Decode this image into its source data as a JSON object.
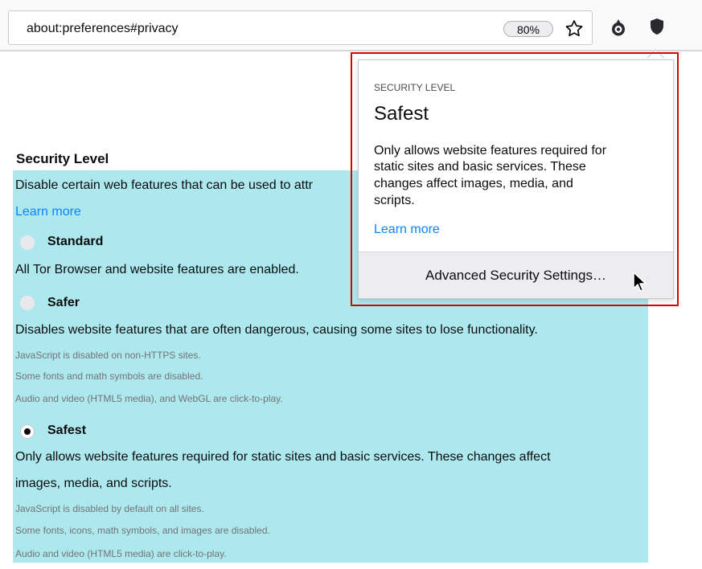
{
  "toolbar": {
    "url": "about:preferences#privacy",
    "zoom": "80%",
    "icons": [
      "star-icon",
      "onion-icon",
      "shield-icon"
    ]
  },
  "security": {
    "title": "Security Level",
    "description": "Disable certain web features that can be used to attr",
    "learn_more": "Learn more",
    "options": {
      "standard": {
        "label": "Standard",
        "description": "All Tor Browser and website features are enabled.",
        "checked": false
      },
      "safer": {
        "label": "Safer",
        "description": "Disables website features that are often dangerous, causing some sites to lose functionality.",
        "notes": [
          "JavaScript is disabled on non-HTTPS sites.",
          "Some fonts and math symbols are disabled.",
          "Audio and video (HTML5 media), and WebGL are click-to-play."
        ],
        "checked": false
      },
      "safest": {
        "label": "Safest",
        "description_line1": "Only allows website features required for static sites and basic services. These changes affect",
        "description_line2": "images, media, and scripts.",
        "notes": [
          "JavaScript is disabled by default on all sites.",
          "Some fonts, icons, math symbols, and images are disabled.",
          "Audio and video (HTML5 media) are click-to-play."
        ],
        "checked": true
      }
    }
  },
  "popup": {
    "heading": "SECURITY LEVEL",
    "level": "Safest",
    "description_lines": [
      "Only allows website features required for",
      "static sites and basic services. These",
      "changes affect images, media, and",
      "scripts."
    ],
    "learn_more": "Learn more",
    "advanced_button": "Advanced Security Settings…"
  },
  "colors": {
    "panel_highlight": "#ade8ef",
    "link": "#0a84ff",
    "frame": "#d50000"
  }
}
